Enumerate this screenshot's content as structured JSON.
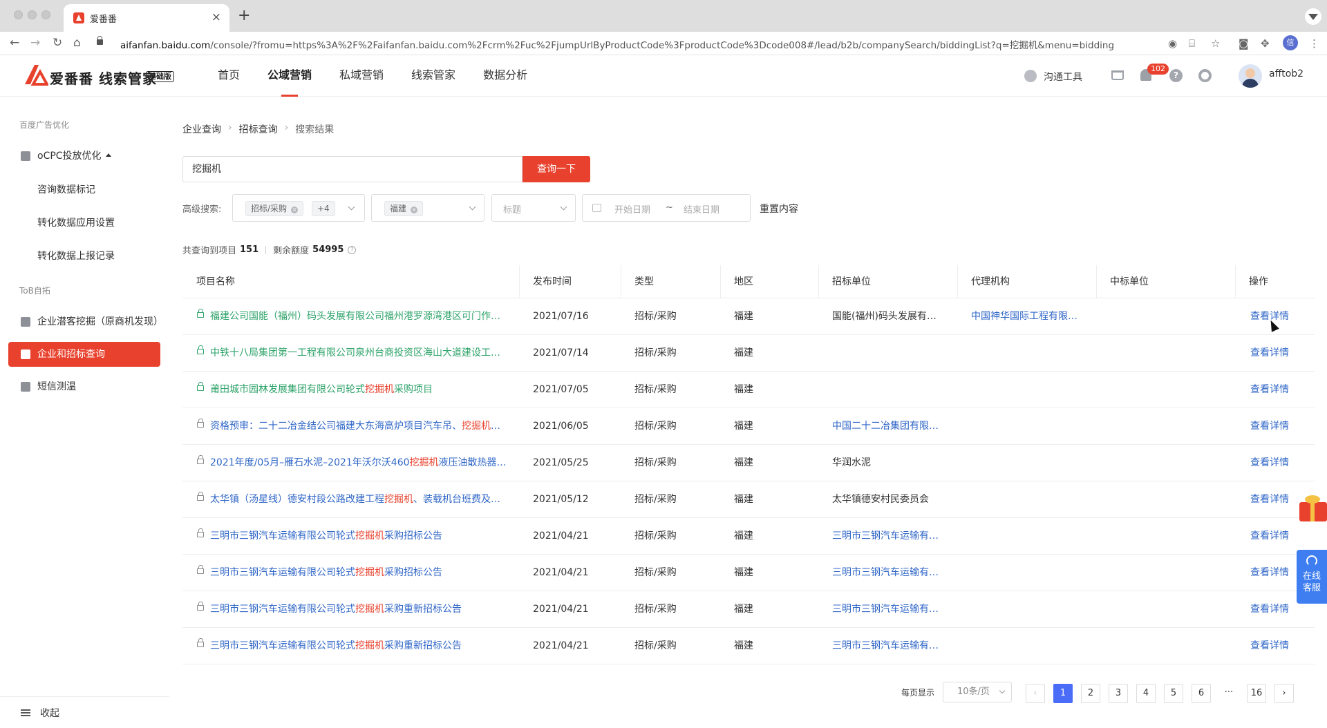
{
  "browser": {
    "tab_title": "爱番番",
    "url_host": "aifanfan.baidu.com",
    "url_rest": "/console/?fromu=https%3A%2F%2Faifanfan.baidu.com%2Fcrm%2Fuc%2FjumpUrlByProductCode%3FproductCode%3Dcode008#/lead/b2b/companySearch/biddingList?q=挖掘机&menu=bidding",
    "profile_initial": "信"
  },
  "header": {
    "logo_text": "爱番番 线索管家",
    "logo_badge": "基础版",
    "nav": [
      "首页",
      "公域营销",
      "私域营销",
      "线索管家",
      "数据分析"
    ],
    "active_nav": "公域营销",
    "tool_label": "沟通工具",
    "notification_count": "102",
    "username": "afftob2"
  },
  "sidebar": {
    "group1": "百度广告优化",
    "ocpc": "oCPC投放优化",
    "ocpc_children": [
      "咨询数据标记",
      "转化数据应用设置",
      "转化数据上报记录"
    ],
    "group2": "ToB自拓",
    "items": [
      "企业潜客挖掘（原商机发现）",
      "企业和招标查询",
      "短信测温"
    ],
    "collapse": "收起"
  },
  "breadcrumb": [
    "企业查询",
    "招标查询",
    "搜索结果"
  ],
  "search": {
    "value": "挖掘机",
    "button": "查询一下"
  },
  "filters": {
    "label": "高级搜索:",
    "type_chip": "招标/采购",
    "type_more": "+4",
    "region_chip": "福建",
    "title_placeholder": "标题",
    "start_placeholder": "开始日期",
    "range_sep": "~",
    "end_placeholder": "结束日期",
    "reset": "重置内容"
  },
  "summary": {
    "total_label": "共查询到项目",
    "total": "151",
    "quota_label": "剩余额度",
    "quota": "54995"
  },
  "table": {
    "columns": [
      "项目名称",
      "发布时间",
      "类型",
      "地区",
      "招标单位",
      "代理机构",
      "中标单位",
      "操作"
    ],
    "rows": [
      {
        "name_pre": "福建公司国能（福州）码头发展有限公司福州港罗源湾港区可门作…",
        "name_hl": "",
        "name_post": "",
        "green": true,
        "date": "2021/07/16",
        "type": "招标/采购",
        "region": "福建",
        "bidder": "国能(福州)码头发展有…",
        "bidder_link": false,
        "agency": "中国神华国际工程有限…",
        "winner": "",
        "op": "查看详情"
      },
      {
        "name_pre": "中铁十八局集团第一工程有限公司泉州台商投资区海山大道建设工…",
        "name_hl": "",
        "name_post": "",
        "green": true,
        "date": "2021/07/14",
        "type": "招标/采购",
        "region": "福建",
        "bidder": "",
        "bidder_link": false,
        "agency": "",
        "winner": "",
        "op": "查看详情"
      },
      {
        "name_pre": "莆田城市园林发展集团有限公司轮式",
        "name_hl": "挖掘机",
        "name_post": "采购项目",
        "green": true,
        "date": "2021/07/05",
        "type": "招标/采购",
        "region": "福建",
        "bidder": "",
        "bidder_link": false,
        "agency": "",
        "winner": "",
        "op": "查看详情"
      },
      {
        "name_pre": "资格预审：二十二冶金结公司福建大东海高炉项目汽车吊、",
        "name_hl": "挖掘机",
        "name_post": "…",
        "green": false,
        "date": "2021/06/05",
        "type": "招标/采购",
        "region": "福建",
        "bidder": "中国二十二冶集团有限…",
        "bidder_link": true,
        "agency": "",
        "winner": "",
        "op": "查看详情"
      },
      {
        "name_pre": "2021年度/05月–雁石水泥–2021年沃尔沃460",
        "name_hl": "挖掘机",
        "name_post": "液压油散热器…",
        "green": false,
        "date": "2021/05/25",
        "type": "招标/采购",
        "region": "福建",
        "bidder": "华润水泥",
        "bidder_link": false,
        "agency": "",
        "winner": "",
        "op": "查看详情"
      },
      {
        "name_pre": "太华镇（汤星线）德安村段公路改建工程",
        "name_hl": "挖掘机",
        "name_post": "、装载机台班费及…",
        "green": false,
        "date": "2021/05/12",
        "type": "招标/采购",
        "region": "福建",
        "bidder": "太华镇德安村民委员会",
        "bidder_link": false,
        "agency": "",
        "winner": "",
        "op": "查看详情"
      },
      {
        "name_pre": "三明市三钢汽车运输有限公司轮式",
        "name_hl": "挖掘机",
        "name_post": "采购招标公告",
        "green": false,
        "date": "2021/04/21",
        "type": "招标/采购",
        "region": "福建",
        "bidder": "三明市三钢汽车运输有…",
        "bidder_link": true,
        "agency": "",
        "winner": "",
        "op": "查看详情"
      },
      {
        "name_pre": "三明市三钢汽车运输有限公司轮式",
        "name_hl": "挖掘机",
        "name_post": "采购招标公告",
        "green": false,
        "date": "2021/04/21",
        "type": "招标/采购",
        "region": "福建",
        "bidder": "三明市三钢汽车运输有…",
        "bidder_link": true,
        "agency": "",
        "winner": "",
        "op": "查看详情"
      },
      {
        "name_pre": "三明市三钢汽车运输有限公司轮式",
        "name_hl": "挖掘机",
        "name_post": "采购重新招标公告",
        "green": false,
        "date": "2021/04/21",
        "type": "招标/采购",
        "region": "福建",
        "bidder": "三明市三钢汽车运输有…",
        "bidder_link": true,
        "agency": "",
        "winner": "",
        "op": "查看详情"
      },
      {
        "name_pre": "三明市三钢汽车运输有限公司轮式",
        "name_hl": "挖掘机",
        "name_post": "采购重新招标公告",
        "green": false,
        "date": "2021/04/21",
        "type": "招标/采购",
        "region": "福建",
        "bidder": "三明市三钢汽车运输有…",
        "bidder_link": true,
        "agency": "",
        "winner": "",
        "op": "查看详情"
      }
    ]
  },
  "pagination": {
    "per_page_label": "每页显示",
    "per_page": "10条/页",
    "pages": [
      "1",
      "2",
      "3",
      "4",
      "5",
      "6",
      "···",
      "16"
    ],
    "current": "1",
    "prev": "‹",
    "next": "›"
  },
  "floating": {
    "service": "在线客服"
  },
  "colors": {
    "brand": "#e8412d",
    "link": "#2f66c7",
    "green": "#2ea36a",
    "page_active": "#4a6cf7"
  }
}
